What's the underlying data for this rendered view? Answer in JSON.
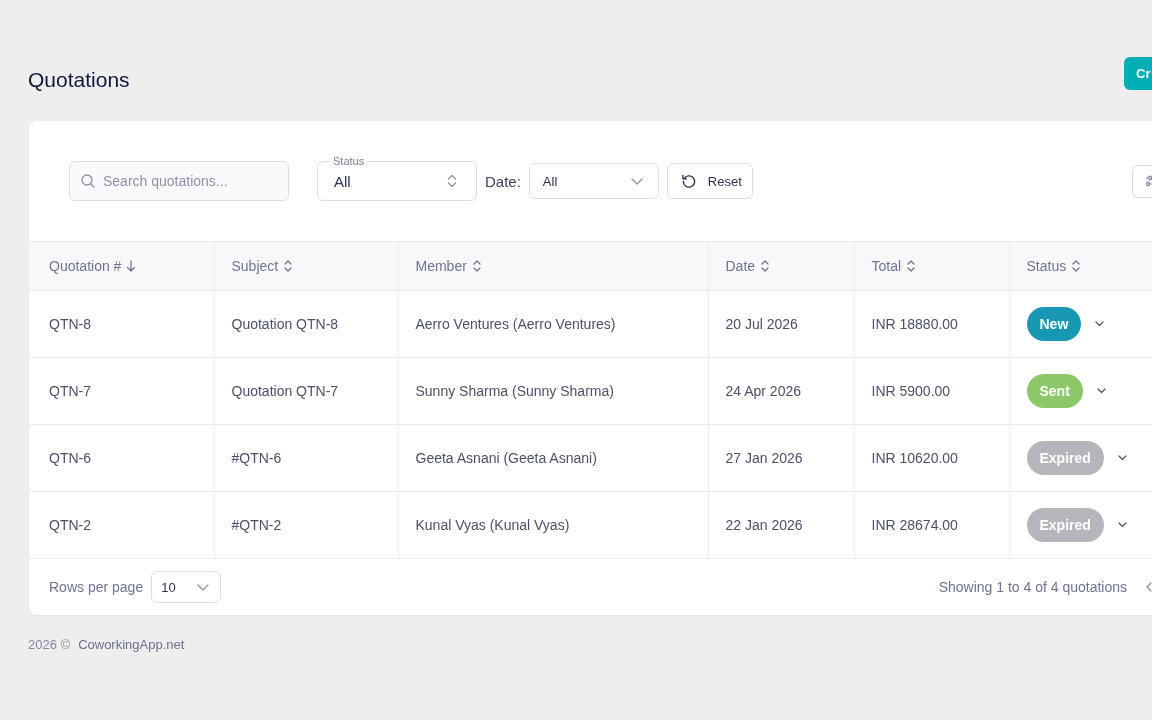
{
  "page": {
    "title": "Quotations",
    "create_button": "Cr"
  },
  "filters": {
    "search": {
      "placeholder": "Search quotations..."
    },
    "status": {
      "label": "Status",
      "value": "All"
    },
    "date": {
      "label": "Date:",
      "value": "All"
    },
    "reset_button": "Reset"
  },
  "table": {
    "columns": [
      {
        "label": "Quotation #",
        "sorted": true
      },
      {
        "label": "Subject",
        "sorted": false
      },
      {
        "label": "Member",
        "sorted": false
      },
      {
        "label": "Date",
        "sorted": false
      },
      {
        "label": "Total",
        "sorted": false
      },
      {
        "label": "Status",
        "sorted": false
      }
    ],
    "rows": [
      {
        "number": "QTN-8",
        "subject": "Quotation QTN-8",
        "member": "Aerro Ventures (Aerro Ventures)",
        "date": "20 Jul 2026",
        "total": "INR 18880.00",
        "status": {
          "label": "New",
          "color": "#1998b4"
        }
      },
      {
        "number": "QTN-7",
        "subject": "Quotation QTN-7",
        "member": "Sunny Sharma (Sunny Sharma)",
        "date": "24 Apr 2026",
        "total": "INR 5900.00",
        "status": {
          "label": "Sent",
          "color": "#8cc86a"
        }
      },
      {
        "number": "QTN-6",
        "subject": "#QTN-6",
        "member": "Geeta Asnani (Geeta Asnani)",
        "date": "27 Jan 2026",
        "total": "INR 10620.00",
        "status": {
          "label": "Expired",
          "color": "#b6b5bc"
        }
      },
      {
        "number": "QTN-2",
        "subject": "#QTN-2",
        "member": "Kunal Vyas (Kunal Vyas)",
        "date": "22 Jan 2026",
        "total": "INR 28674.00",
        "status": {
          "label": "Expired",
          "color": "#b6b5bc"
        }
      }
    ]
  },
  "pagination": {
    "rows_per_page_label": "Rows per page",
    "rows_per_page": "10",
    "summary": "Showing 1 to 4 of 4 quotations"
  },
  "footer": {
    "copyright": "2026 ©",
    "link": "CoworkingApp.net"
  }
}
